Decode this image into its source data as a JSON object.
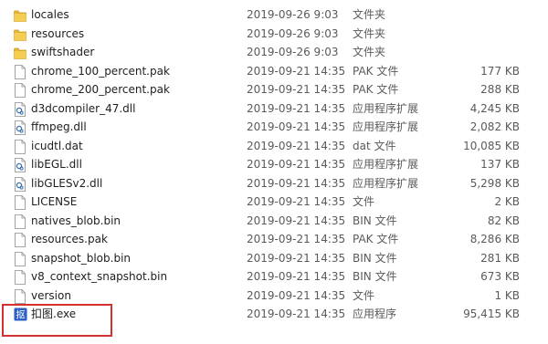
{
  "files": [
    {
      "name": "locales",
      "date": "2019-09-26 9:03",
      "type": "文件夹",
      "size": "",
      "icon": "folder-icon"
    },
    {
      "name": "resources",
      "date": "2019-09-26 9:03",
      "type": "文件夹",
      "size": "",
      "icon": "folder-icon"
    },
    {
      "name": "swiftshader",
      "date": "2019-09-26 9:03",
      "type": "文件夹",
      "size": "",
      "icon": "folder-icon"
    },
    {
      "name": "chrome_100_percent.pak",
      "date": "2019-09-21 14:35",
      "type": "PAK 文件",
      "size": "177 KB",
      "icon": "file-icon"
    },
    {
      "name": "chrome_200_percent.pak",
      "date": "2019-09-21 14:35",
      "type": "PAK 文件",
      "size": "288 KB",
      "icon": "file-icon"
    },
    {
      "name": "d3dcompiler_47.dll",
      "date": "2019-09-21 14:35",
      "type": "应用程序扩展",
      "size": "4,245 KB",
      "icon": "dll-icon"
    },
    {
      "name": "ffmpeg.dll",
      "date": "2019-09-21 14:35",
      "type": "应用程序扩展",
      "size": "2,082 KB",
      "icon": "dll-icon"
    },
    {
      "name": "icudtl.dat",
      "date": "2019-09-21 14:35",
      "type": "dat 文件",
      "size": "10,085 KB",
      "icon": "file-icon"
    },
    {
      "name": "libEGL.dll",
      "date": "2019-09-21 14:35",
      "type": "应用程序扩展",
      "size": "137 KB",
      "icon": "dll-icon"
    },
    {
      "name": "libGLESv2.dll",
      "date": "2019-09-21 14:35",
      "type": "应用程序扩展",
      "size": "5,298 KB",
      "icon": "dll-icon"
    },
    {
      "name": "LICENSE",
      "date": "2019-09-21 14:35",
      "type": "文件",
      "size": "2 KB",
      "icon": "file-icon"
    },
    {
      "name": "natives_blob.bin",
      "date": "2019-09-21 14:35",
      "type": "BIN 文件",
      "size": "82 KB",
      "icon": "file-icon"
    },
    {
      "name": "resources.pak",
      "date": "2019-09-21 14:35",
      "type": "PAK 文件",
      "size": "8,286 KB",
      "icon": "file-icon"
    },
    {
      "name": "snapshot_blob.bin",
      "date": "2019-09-21 14:35",
      "type": "BIN 文件",
      "size": "281 KB",
      "icon": "file-icon"
    },
    {
      "name": "v8_context_snapshot.bin",
      "date": "2019-09-21 14:35",
      "type": "BIN 文件",
      "size": "673 KB",
      "icon": "file-icon"
    },
    {
      "name": "version",
      "date": "2019-09-21 14:35",
      "type": "文件",
      "size": "1 KB",
      "icon": "file-icon"
    },
    {
      "name": "扣图.exe",
      "date": "2019-09-21 14:35",
      "type": "应用程序",
      "size": "95,415 KB",
      "icon": "exe-icon"
    }
  ],
  "exe_icon_glyph": "抠",
  "colors": {
    "folder": "#e8b730",
    "highlight": "#d43030",
    "exe_badge": "#2a5fc4"
  }
}
